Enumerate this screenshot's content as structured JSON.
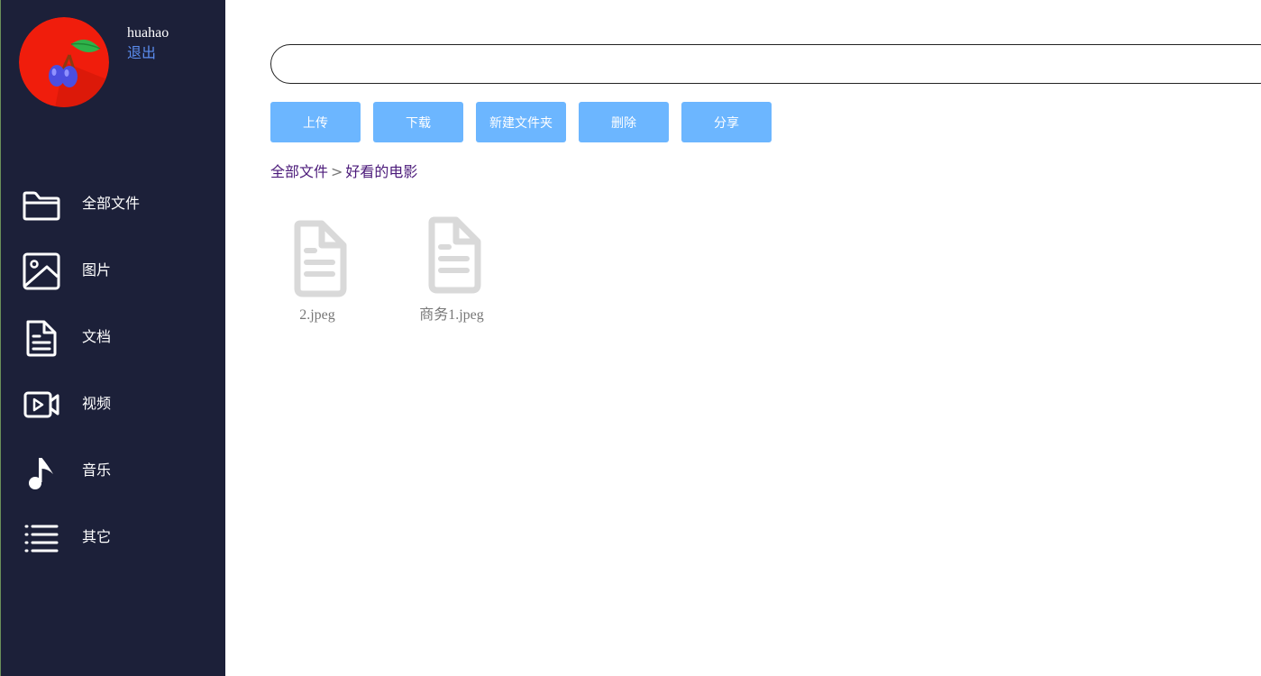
{
  "user": {
    "name": "huahao",
    "logout_label": "退出"
  },
  "sidebar": {
    "items": [
      {
        "label": "全部文件",
        "icon": "folder-icon"
      },
      {
        "label": "图片",
        "icon": "image-icon"
      },
      {
        "label": "文档",
        "icon": "document-icon"
      },
      {
        "label": "视频",
        "icon": "video-icon"
      },
      {
        "label": "音乐",
        "icon": "music-icon"
      },
      {
        "label": "其它",
        "icon": "list-icon"
      }
    ]
  },
  "search": {
    "value": "",
    "placeholder": ""
  },
  "toolbar": {
    "upload_label": "上传",
    "download_label": "下载",
    "new_folder_label": "新建文件夹",
    "delete_label": "删除",
    "share_label": "分享"
  },
  "breadcrumb": {
    "items": [
      "全部文件",
      "好看的电影"
    ],
    "separator": ">"
  },
  "files": [
    {
      "name": "2.jpeg",
      "icon": "file-icon"
    },
    {
      "name": "商务1.jpeg",
      "icon": "file-icon"
    }
  ],
  "colors": {
    "sidebar_bg": "#1c2039",
    "accent": "#6cb6ff",
    "logout_link": "#5b8def",
    "breadcrumb_link": "#4b1a7a",
    "file_icon": "#d9d9d9"
  }
}
